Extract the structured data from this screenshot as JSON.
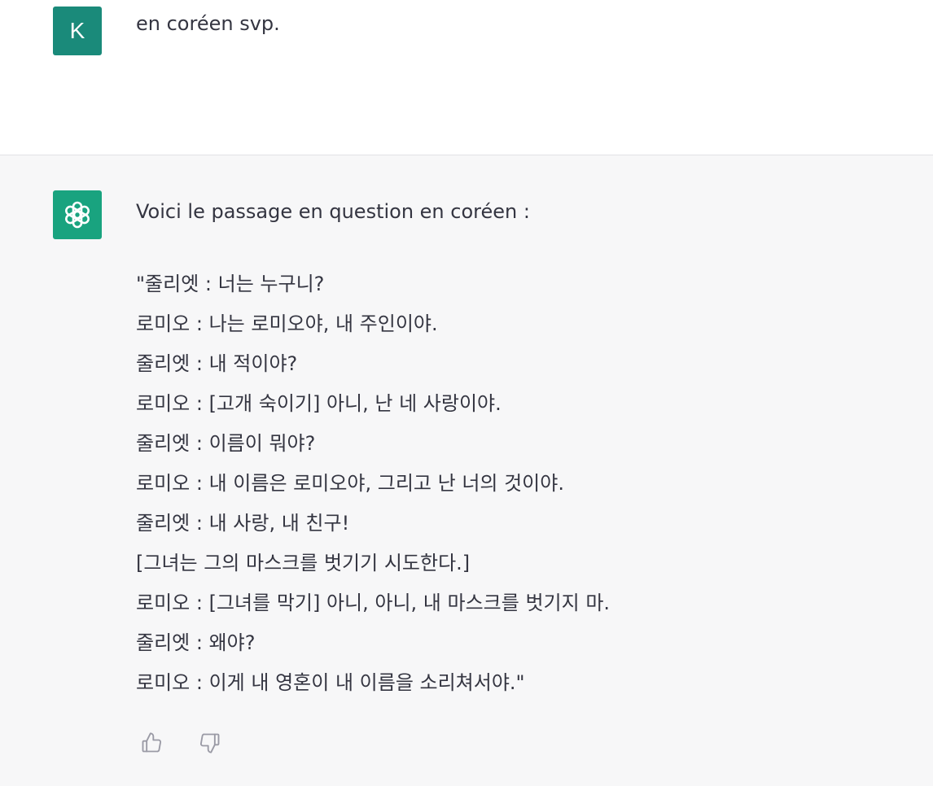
{
  "user_message": {
    "avatar_letter": "K",
    "text": "en coréen svp."
  },
  "assistant_message": {
    "avatar_icon": "openai-logo-icon",
    "intro": "Voici le passage en question en coréen :",
    "lines": [
      "\"줄리엣 : 너는 누구니?",
      "로미오 : 나는 로미오야, 내 주인이야.",
      "줄리엣 : 내 적이야?",
      "로미오 : [고개 숙이기] 아니, 난 네 사랑이야.",
      "줄리엣 : 이름이 뭐야?",
      "로미오 : 내 이름은 로미오야, 그리고 난 너의 것이야.",
      "줄리엣 : 내 사랑, 내 친구!",
      "[그녀는 그의 마스크를 벗기기 시도한다.]",
      "로미오 : [그녀를 막기] 아니, 아니, 내 마스크를 벗기지 마.",
      "줄리엣 : 왜야?",
      "로미오 : 이게 내 영혼이 내 이름을 소리쳐서야.\""
    ],
    "feedback": {
      "thumbs_up_icon": "thumbs-up-icon",
      "thumbs_down_icon": "thumbs-down-icon"
    }
  },
  "colors": {
    "user_avatar_bg": "#1a8a7a",
    "bot_avatar_bg": "#19a37f",
    "assistant_bg": "#f7f7f8",
    "text": "#343541"
  }
}
